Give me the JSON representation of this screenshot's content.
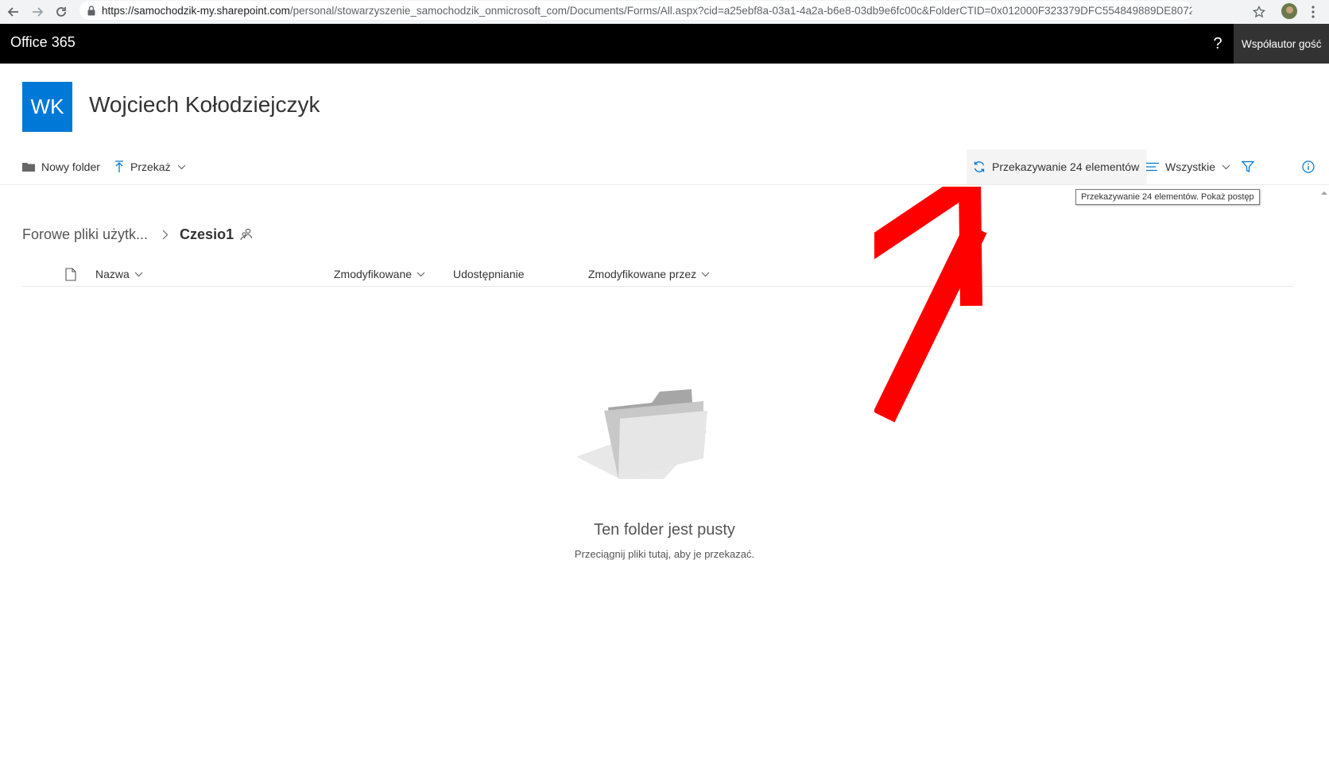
{
  "browser": {
    "url_host": "https://samochodzik-my.sharepoint.com",
    "url_rest": "/personal/stowarzyszenie_samochodzik_onmicrosoft_com/Documents/Forms/All.aspx?cid=a25ebf8a-03a1-4a2a-b6e8-03db9e6fc00c&FolderCTID=0x012000F323379DFC554849889DE8072..."
  },
  "suitebar": {
    "brand": "Office 365",
    "help": "?",
    "user": "Współautor gość"
  },
  "site": {
    "logo_initials": "WK",
    "title": "Wojciech Kołodziejczyk",
    "accent": "#0078d7"
  },
  "commandbar": {
    "new_folder": "Nowy folder",
    "upload": "Przekaż",
    "upload_status": "Przekazywanie 24 elementów",
    "view": "Wszystkie"
  },
  "tooltip": {
    "text": "Przekazywanie 24 elementów. Pokaż postęp"
  },
  "breadcrumb": {
    "parent": "Forowe pliki użytk...",
    "current": "Czesio1"
  },
  "columns": {
    "name": "Nazwa",
    "modified": "Zmodyfikowane",
    "sharing": "Udostępnianie",
    "modified_by": "Zmodyfikowane przez"
  },
  "empty_state": {
    "title": "Ten folder jest pusty",
    "subtitle": "Przeciągnij pliki tutaj, aby je przekazać."
  },
  "annotation": {
    "color": "#ff0000",
    "icon": "red-arrow"
  }
}
